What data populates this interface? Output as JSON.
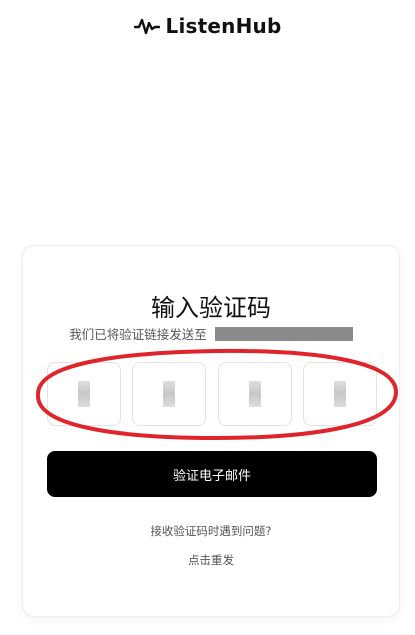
{
  "header": {
    "logo_text": "ListenHub",
    "logo_icon": "waveform-icon"
  },
  "card": {
    "title": "输入验证码",
    "subtitle": "我们已将验证链接发送至",
    "code_boxes": 4,
    "verify_button_label": "验证电子邮件",
    "trouble_text": "接收验证码时遇到问题?",
    "resend_label": "点击重发"
  },
  "colors": {
    "primary_button": "#000000",
    "annotation": "#e0242c",
    "text_muted": "#555555"
  }
}
